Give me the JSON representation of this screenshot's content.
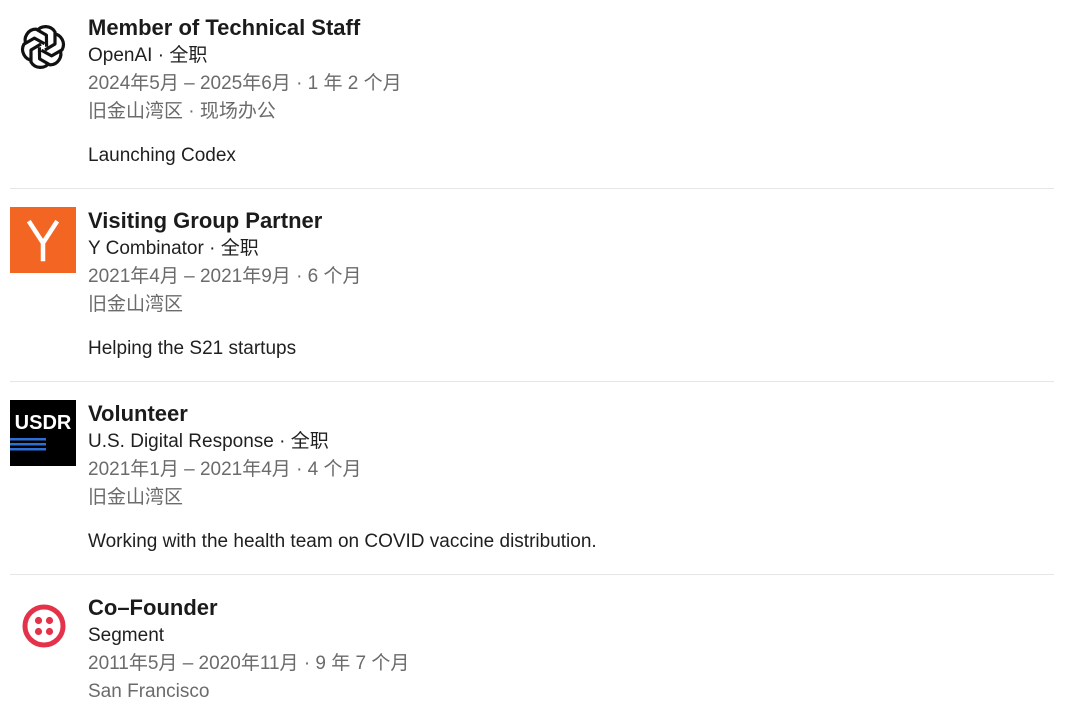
{
  "experiences": [
    {
      "title": "Member of Technical Staff",
      "company_line": "OpenAI · 全职",
      "dates": "2024年5月 – 2025年6月 · 1 年 2 个月",
      "location": "旧金山湾区 · 现场办公",
      "description": "Launching Codex",
      "logo_icon": "openai-logo-icon"
    },
    {
      "title": "Visiting Group Partner",
      "company_line": "Y Combinator · 全职",
      "dates": "2021年4月 – 2021年9月 · 6 个月",
      "location": "旧金山湾区",
      "description": "Helping the S21 startups",
      "logo_icon": "ycombinator-logo-icon",
      "logo_text": "Y",
      "logo_color": "#f26522"
    },
    {
      "title": "Volunteer",
      "company_line": "U.S. Digital Response · 全职",
      "dates": "2021年1月 – 2021年4月 · 4 个月",
      "location": "旧金山湾区",
      "description": "Working with the health team on COVID vaccine distribution.",
      "logo_icon": "usdr-logo-icon",
      "logo_text": "USDR",
      "logo_color": "#000000",
      "logo_stripe_color": "#2d6fd6"
    },
    {
      "title": "Co–Founder",
      "company_line": "Segment",
      "dates": "2011年5月 – 2020年11月 · 9 年 7 个月",
      "location": "San Francisco",
      "logo_icon": "segment-logo-icon",
      "logo_color": "#e5324b"
    }
  ]
}
